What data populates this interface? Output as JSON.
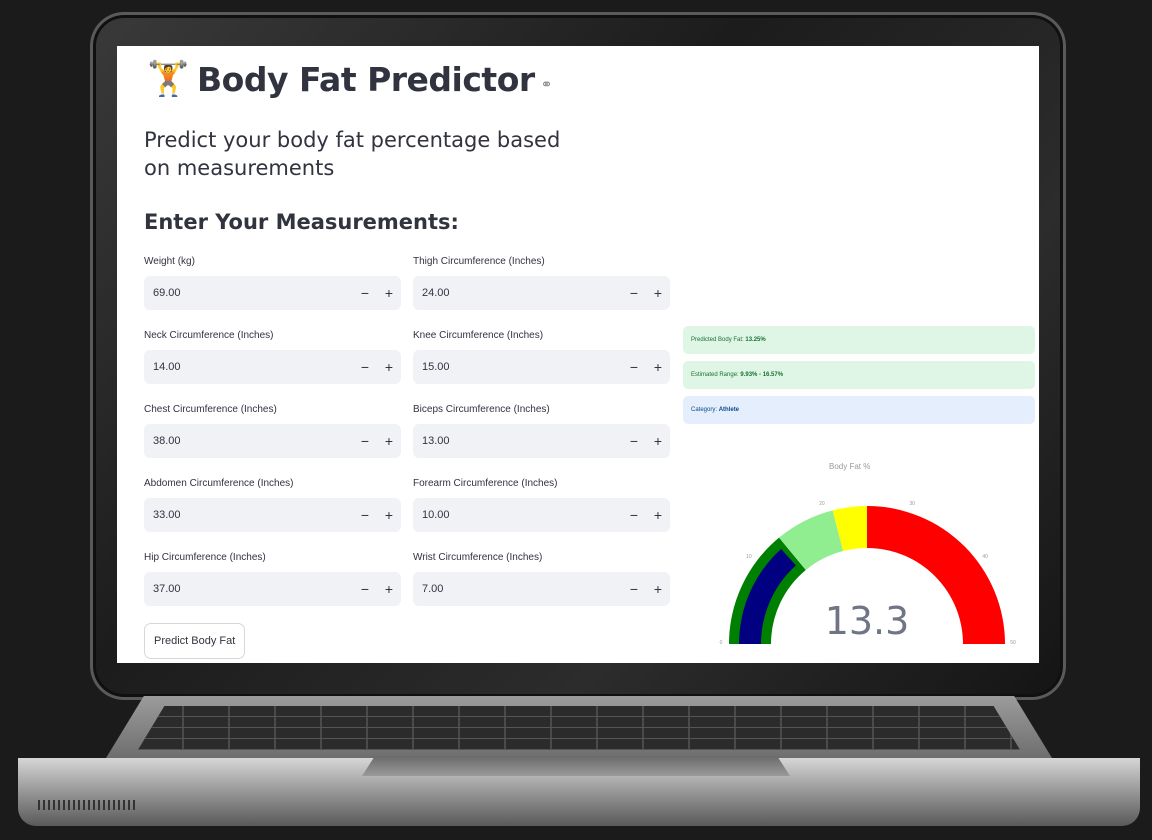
{
  "app": {
    "title_emoji": "🏋️",
    "title": "Body Fat Predictor",
    "subtitle": "Predict your body fat percentage based on measurements",
    "section_header": "Enter Your Measurements:",
    "predict_button": "Predict Body Fat"
  },
  "fields": [
    {
      "label": "Weight (kg)",
      "value": "69.00"
    },
    {
      "label": "Thigh Circumference (Inches)",
      "value": "24.00"
    },
    {
      "label": "Neck Circumference (Inches)",
      "value": "14.00"
    },
    {
      "label": "Knee Circumference (Inches)",
      "value": "15.00"
    },
    {
      "label": "Chest Circumference (Inches)",
      "value": "38.00"
    },
    {
      "label": "Biceps Circumference (Inches)",
      "value": "13.00"
    },
    {
      "label": "Abdomen Circumference (Inches)",
      "value": "33.00"
    },
    {
      "label": "Forearm Circumference (Inches)",
      "value": "10.00"
    },
    {
      "label": "Hip Circumference (Inches)",
      "value": "37.00"
    },
    {
      "label": "Wrist Circumference (Inches)",
      "value": "7.00"
    }
  ],
  "stepper": {
    "minus": "−",
    "plus": "+"
  },
  "results": {
    "predicted_label": "Predicted Body Fat:",
    "predicted_value": "13.25%",
    "range_label": "Estimated Range:",
    "range_value": "9.93% - 16.57%",
    "category_label": "Category:",
    "category_value": "Athlete"
  },
  "colors": {
    "green_alert_bg": "#dff5e6",
    "blue_alert_bg": "#e4eefc",
    "input_bg": "#f0f2f6"
  },
  "chart_data": {
    "type": "gauge",
    "title": "Body Fat %",
    "value": 13.3,
    "range": [
      0,
      50
    ],
    "bar_color": "#000080",
    "steps": [
      {
        "from": 0,
        "to": 14,
        "color": "#008000"
      },
      {
        "from": 14,
        "to": 21,
        "color": "#90ee90"
      },
      {
        "from": 21,
        "to": 25,
        "color": "#ffff00"
      },
      {
        "from": 25,
        "to": 50,
        "color": "#ff0000"
      }
    ],
    "ticks": [
      0,
      10,
      20,
      30,
      40,
      50
    ]
  }
}
